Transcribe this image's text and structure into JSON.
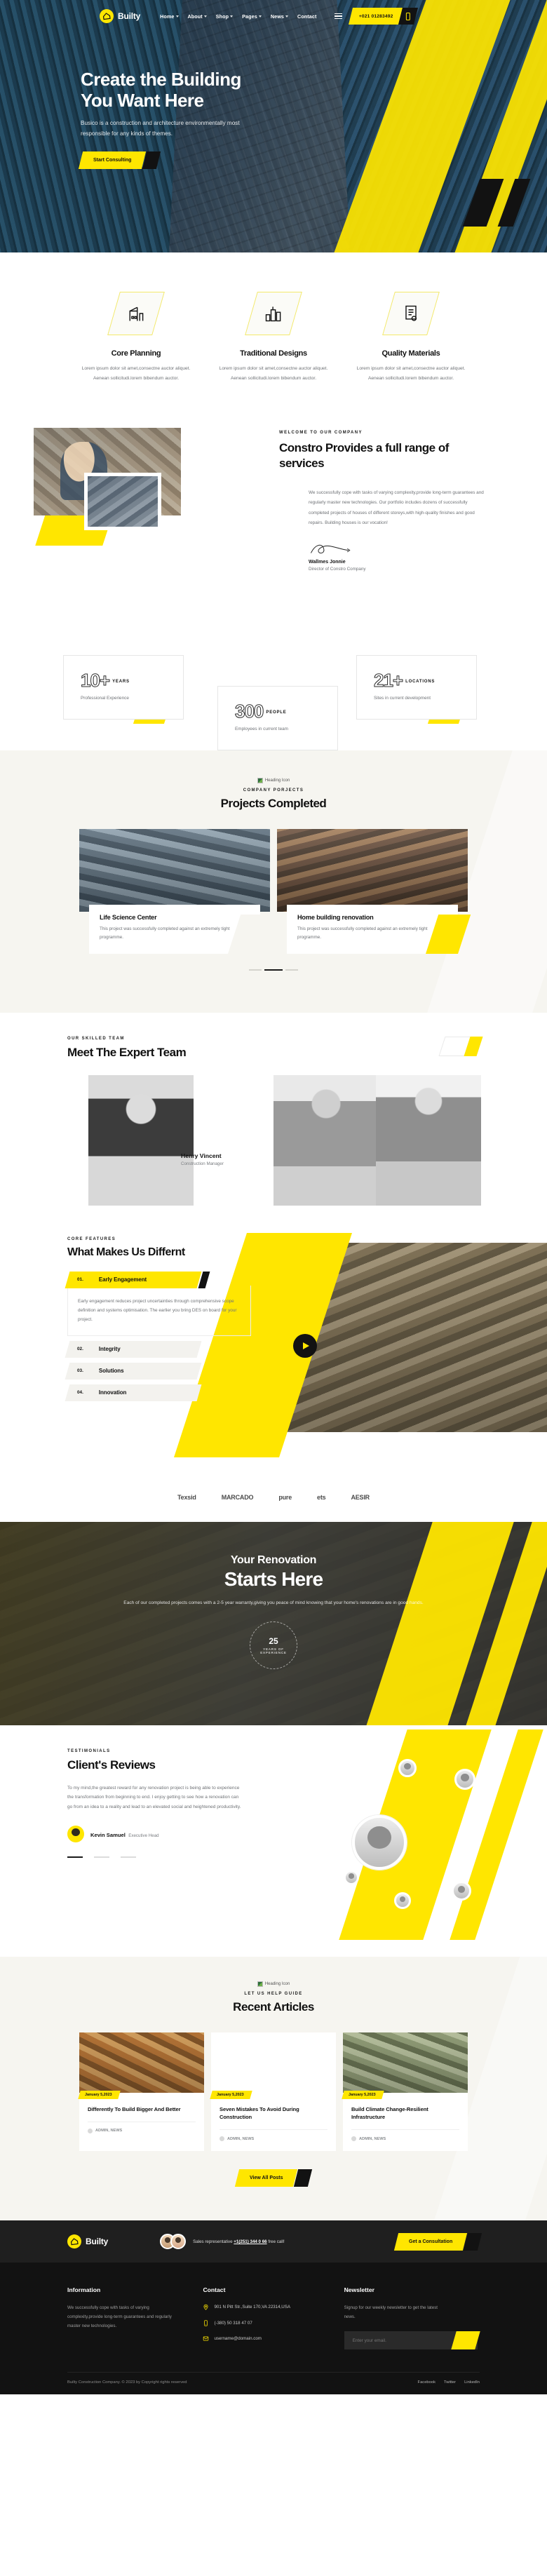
{
  "brand": {
    "name": "Builty",
    "logo_icon": "house-yellow-icon"
  },
  "header": {
    "nav": [
      {
        "label": "Home",
        "has_dropdown": true
      },
      {
        "label": "About",
        "has_dropdown": true
      },
      {
        "label": "Shop",
        "has_dropdown": true
      },
      {
        "label": "Pages",
        "has_dropdown": true
      },
      {
        "label": "News",
        "has_dropdown": true
      },
      {
        "label": "Contact",
        "has_dropdown": false
      }
    ],
    "menu_icon": "hamburger-icon",
    "phone": "+021 01283492",
    "phone_icon": "mobile-phone-icon"
  },
  "hero": {
    "title_line1": "Create the Building",
    "title_line2": "You Want Here",
    "subtitle": "Busico is a construction and architecture environmentally most responsible for any kinds of themes.",
    "button": "Start Consulting"
  },
  "services": [
    {
      "icon": "crane-building-icon",
      "title": "Core Planning",
      "text": "Lorem ipsum dolor sit amet,consectne auctor aliquet. Aenean sollicitudi.lorem bibendum auctor."
    },
    {
      "icon": "city-skyline-icon",
      "title": "Traditional Designs",
      "text": "Lorem ipsum dolor sit amet,consectne auctor aliquet. Aenean sollicitudi.lorem bibendum auctor."
    },
    {
      "icon": "certificate-document-icon",
      "title": "Quality Materials",
      "text": "Lorem ipsum dolor sit amet,consectne auctor aliquet. Aenean sollicitudi.lorem bibendum auctor."
    }
  ],
  "about": {
    "eyebrow": "WELCOME TO OUR COMPANY",
    "title": "Constro Provides a full range of services",
    "body": "We successfully cope with tasks of varying complexity,provide long-term guarantees and regularly master new technologies. Our portfolio includes dozens of successfully completed projects of houses of different storeys,with high-quality finishes and good repairs. Building houses is our vocation!",
    "signature_name": "Wallmes Jonnie",
    "signature_role": "Director of Constro Company"
  },
  "counters": [
    {
      "number": "10+",
      "unit": "YEARS",
      "label": "Professional Experience"
    },
    {
      "number": "300",
      "unit": "PEOPLE",
      "label": "Employees in current team"
    },
    {
      "number": "21+",
      "unit": "LOCATIONS",
      "label": "Sites in current development"
    }
  ],
  "projects": {
    "heading_icon_alt": "Heading Icon",
    "eyebrow": "COMPANY PORJECTS",
    "title": "Projects Completed",
    "items": [
      {
        "title": "Life Science Center",
        "text": "This project was successfully completed against an extremely tight programme."
      },
      {
        "title": "Home building renovation",
        "text": "This project was successfully completed against an extremely tight programme."
      }
    ]
  },
  "team": {
    "eyebrow": "OUR SKILLED TEAM",
    "title": "Meet The Expert Team",
    "members": [
      {
        "name": "Henry Vincent",
        "role": "Construction Manager"
      }
    ]
  },
  "different": {
    "eyebrow": "CORE FEATURES",
    "title": "What Makes Us Differnt",
    "items": [
      {
        "number": "01.",
        "title": "Early Engagement",
        "active": true,
        "body": "Early engagement reduces project uncertainties through comprehensive scope definition and systems optimisation. The earlier you bring DES on board for your project."
      },
      {
        "number": "02.",
        "title": "Integrity",
        "active": false,
        "body": ""
      },
      {
        "number": "03.",
        "title": "Solutions",
        "active": false,
        "body": ""
      },
      {
        "number": "04.",
        "title": "Innovation",
        "active": false,
        "body": ""
      }
    ],
    "play_icon": "play-button-icon"
  },
  "brands": [
    "Texsid",
    "MARCADO",
    "pure",
    "ets",
    "AESIR"
  ],
  "renovation": {
    "title_small": "Your Renovation",
    "title_big": "Starts Here",
    "text": "Each of our completed projects comes with a 2-5 year warranty,giving you peace of mind knowing that your home's renovations are in good hands.",
    "badge_year": "25",
    "badge_text": "YEARS OF EXPERIENCE"
  },
  "testimonials": {
    "eyebrow": "TESTIMONIALS",
    "title": "Client's Reviews",
    "quote": "To my mind,the greatest reward for any renovation project is being able to experience the transformation from beginning to end. I enjoy getting to see how a renovation can go from an idea to a reality and lead to an elevated social and heightened productivity.",
    "author_name": "Kevin Samuel",
    "author_role": "Executive Head"
  },
  "articles": {
    "heading_icon_alt": "Heading Icon",
    "eyebrow": "LET US HELP GUIDE",
    "title": "Recent Articles",
    "items": [
      {
        "date": "January 5,2023",
        "title": "Differently To Build Bigger And Better",
        "meta": "ADMIN, NEWS"
      },
      {
        "date": "January 5,2023",
        "title": "Seven Mistakes To Avoid During Construction",
        "meta": "ADMIN, NEWS"
      },
      {
        "date": "January 5,2023",
        "title": "Build Climate Change-Resilient Infrastructure",
        "meta": "ADMIN, NEWS"
      }
    ],
    "view_all": "View All Posts"
  },
  "footer_cta": {
    "rep_prefix": "Sales representative",
    "rep_phone": "+1(251) 344 0 66",
    "rep_suffix": "free call!",
    "button": "Get a Consultation"
  },
  "footer": {
    "information": {
      "title": "Information",
      "text": "We successfully cope with tasks of varying complexity,provide long-term guarantees and regularly master new technologies."
    },
    "contact": {
      "title": "Contact",
      "address_icon": "map-pin-icon",
      "address": "901 N Pitt Str.,Suite 170,VA 22314,USA",
      "phone_icon": "mobile-phone-icon",
      "phone": "(-380) 50 318 47 07",
      "email_icon": "envelope-icon",
      "email": "username@domain.com"
    },
    "newsletter": {
      "title": "Newsletter",
      "text": "Signup for our weekly newsletter to get the latest news.",
      "placeholder": "Enter your email.",
      "submit_icon": "arrow-right-icon"
    },
    "copyright": "Builty Construction Company. © 2023 by Copyright rights reserved",
    "social": [
      "Facebook",
      "Twitter",
      "LinkedIn"
    ]
  },
  "colors": {
    "accent": "#FFE600",
    "dark": "#121212",
    "cream": "#F6F5F0"
  }
}
